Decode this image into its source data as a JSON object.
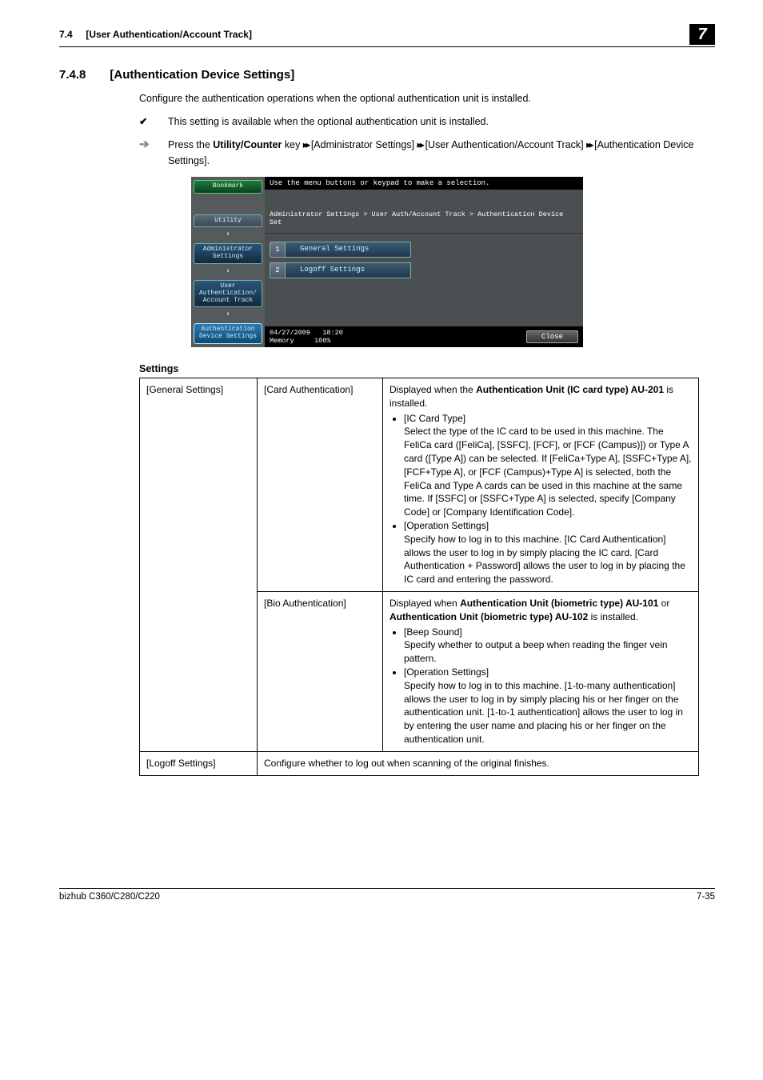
{
  "header": {
    "section_ref": "7.4",
    "section_path": "[User Authentication/Account Track]",
    "chapter_badge": "7"
  },
  "section": {
    "number": "7.4.8",
    "title": "[Authentication Device Settings]",
    "intro": "Configure the authentication operations when the optional authentication unit is installed.",
    "check_note": "This setting is available when the optional authentication unit is installed.",
    "arrow_prefix": "Press the ",
    "arrow_key_bold": "Utility/Counter",
    "arrow_key_tail": " key ",
    "arrow_path": " [Administrator Settings] ",
    "arrow_path2": " [User Authentication/Account Track] ",
    "arrow_path3": " [Authentication Device Settings]."
  },
  "screenshot": {
    "top_text": "Use the menu buttons or keypad to make a selection.",
    "breadcrumb": "Administrator Settings > User Auth/Account Track > Authentication Device Set",
    "sidebar": {
      "bookmark": "Bookmark",
      "utility": "Utility",
      "admin": "Administrator Settings",
      "userauth": "User Authentication/ Account Track",
      "authdev": "Authentication Device Settings"
    },
    "options": [
      {
        "num": "1",
        "label": "General Settings"
      },
      {
        "num": "2",
        "label": "Logoff Settings"
      }
    ],
    "footer": {
      "date": "04/27/2009",
      "time": "18:20",
      "memory_label": "Memory",
      "memory_value": "100%",
      "close": "Close"
    }
  },
  "settings": {
    "heading": "Settings",
    "rows": {
      "general_label": "[General Settings]",
      "card_auth_label": "[Card Authentication]",
      "card_auth_intro_pre": "Displayed when the ",
      "card_auth_intro_bold": "Authentication Unit (IC card type) AU-201",
      "card_auth_intro_post": " is installed.",
      "card_item1_title": "[IC Card Type]",
      "card_item1_body": "Select the type of the IC card to be used in this machine. The FeliCa card ([FeliCa], [SSFC], [FCF], or [FCF (Campus)]) or Type A card ([Type A]) can be selected. If [FeliCa+Type A], [SSFC+Type A], [FCF+Type A], or  [FCF (Campus)+Type A] is selected, both the FeliCa and Type A cards can be used in this machine at the same time. If [SSFC] or [SSFC+Type A] is selected, specify [Company Code] or [Company Identification Code].",
      "card_item2_title": "[Operation Settings]",
      "card_item2_body": "Specify how to log in to this machine. [IC Card Authentication] allows the user to log in by simply placing the IC card. [Card Authentication + Password] allows the user to log in by placing the IC card and entering the password.",
      "bio_auth_label": "[Bio Authentication]",
      "bio_intro_pre": "Displayed when ",
      "bio_intro_bold1": "Authentication Unit (biometric type) AU-101",
      "bio_intro_mid": " or ",
      "bio_intro_bold2": "Authentication Unit (biometric type) AU-102",
      "bio_intro_post": " is installed.",
      "bio_item1_title": "[Beep Sound]",
      "bio_item1_body": "Specify whether to output a beep when reading the finger vein pattern.",
      "bio_item2_title": "[Operation Settings]",
      "bio_item2_body": "Specify how to log in to this machine. [1-to-many authentication] allows the user to log in by simply placing his or her finger on the authentication unit. [1-to-1 authentication] allows the user to log in by entering the user name and placing his or her finger on the authentication unit.",
      "logoff_label": "[Logoff Settings]",
      "logoff_body": "Configure whether to log out when scanning of the original finishes."
    }
  },
  "footer": {
    "model": "bizhub C360/C280/C220",
    "page": "7-35"
  },
  "glyphs": {
    "check": "✔",
    "arrow": "➔",
    "nav": "▸▸"
  }
}
